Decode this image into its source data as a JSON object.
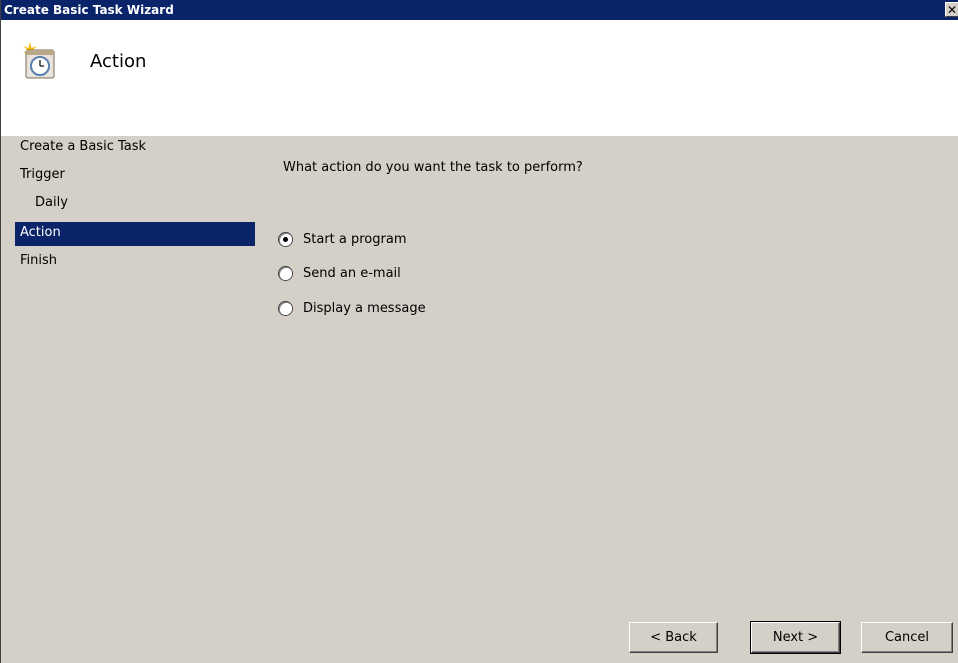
{
  "window": {
    "title": "Create Basic Task Wizard",
    "close_label": "✕"
  },
  "header": {
    "title": "Action",
    "icon": "task-scheduler-clock-icon"
  },
  "nav": {
    "items": [
      {
        "label": "Create a Basic Task",
        "active": false
      },
      {
        "label": "Trigger",
        "active": false
      },
      {
        "label": "Daily",
        "active": false
      },
      {
        "label": "Action",
        "active": true
      },
      {
        "label": "Finish",
        "active": false
      }
    ]
  },
  "main": {
    "question": "What action do you want the task to perform?",
    "options": [
      {
        "label": "Start a program",
        "checked": true
      },
      {
        "label": "Send an e-mail",
        "checked": false
      },
      {
        "label": "Display a message",
        "checked": false
      }
    ]
  },
  "buttons": {
    "back": "< Back",
    "next": "Next >",
    "cancel": "Cancel"
  },
  "colors": {
    "titlebar": "#0a246a",
    "face": "#d4d0c8",
    "selection": "#0a246a"
  }
}
